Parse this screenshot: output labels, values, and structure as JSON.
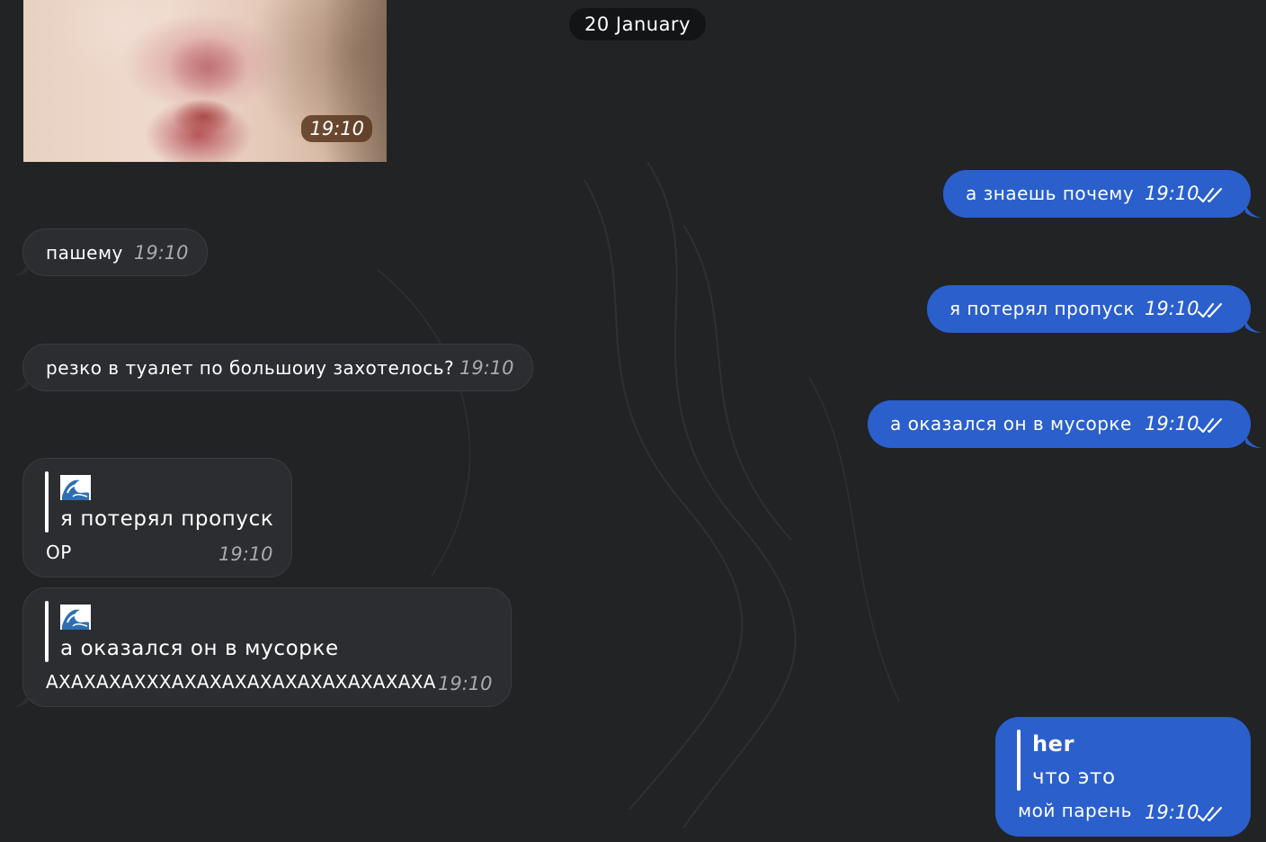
{
  "date_separator": "20 January",
  "photo": {
    "time": "19:10"
  },
  "messages": [
    {
      "text": "а знаешь почему",
      "time": "19:10"
    },
    {
      "text": "пашему",
      "time": "19:10"
    },
    {
      "text": "я потерял пропуск",
      "time": "19:10"
    },
    {
      "text": "резко в туалет по большоиу захотелось?",
      "time": "19:10"
    },
    {
      "text": "а оказался он в мусорке",
      "time": "19:10"
    },
    {
      "reply_quote": "я потерял пропуск",
      "text": "ОР",
      "time": "19:10"
    },
    {
      "reply_quote": "а оказался он в мусорке",
      "text": "АХАХАХАХХХАХАХАХАХАХАХАХАХАХАХА",
      "time": "19:10"
    },
    {
      "reply_author": "her",
      "reply_quote": "что это",
      "text": "мой парень",
      "time": "19:10"
    }
  ],
  "colors": {
    "outgoing": "#2a5fcc",
    "incoming": "#2b2d30",
    "background": "#212325"
  },
  "icons": {
    "read_receipt": "double-check-icon",
    "reply_thumb": "wave-emoji-icon"
  }
}
